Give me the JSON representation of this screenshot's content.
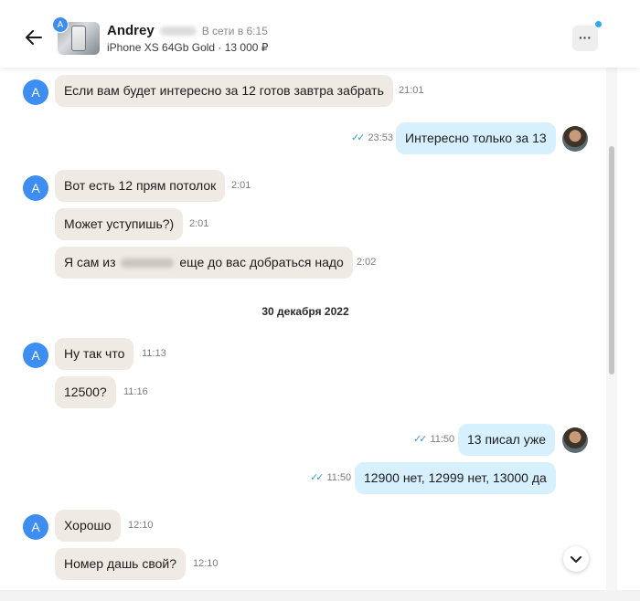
{
  "header": {
    "name": "Andrey",
    "status": "В сети в 6:15",
    "item": "iPhone XS 64Gb Gold · 13 000 ₽",
    "avatar_letter": "А",
    "icons": {
      "back": "arrow-left-icon",
      "menu": "more-horizontal-icon",
      "scroll": "chevron-down-icon"
    },
    "menu_label": "···"
  },
  "messages": [
    {
      "from": "them",
      "avatar": "A",
      "text": "Если вам будет интересно за 12 готов завтра забрать",
      "time": "21:01"
    },
    {
      "from": "me",
      "text": "Интересно только за 13",
      "time": "23:53",
      "read": true
    },
    {
      "from": "them",
      "avatar": "A",
      "text": "Вот есть 12 прям потолок",
      "time": "2:01"
    },
    {
      "from": "them",
      "text": "Может уступишь?)",
      "time": "2:01"
    },
    {
      "from": "them",
      "text_before": "Я сам из",
      "text_after": "еще до вас добраться надо",
      "time": "2:02"
    },
    {
      "from": "them",
      "avatar": "A",
      "text": "Ну так что",
      "time": "11:13"
    },
    {
      "from": "them",
      "text": "12500?",
      "time": "11:16"
    },
    {
      "from": "me",
      "text": "13 писал уже",
      "time": "11:50",
      "read": true
    },
    {
      "from": "me",
      "text": "12900 нет, 12999 нет, 13000 да",
      "time": "11:50",
      "read": true
    },
    {
      "from": "them",
      "avatar": "A",
      "text": "Хорошо",
      "time": "12:10"
    },
    {
      "from": "them",
      "text": "Номер дашь свой?",
      "time": "12:10"
    }
  ],
  "date_separator": "30 декабря 2022",
  "read_mark": "✓✓",
  "colors": {
    "incoming": "#efeae3",
    "outgoing": "#d7f0fd",
    "accent": "#3d8ef0",
    "read_ticks": "#3a9bd9"
  }
}
